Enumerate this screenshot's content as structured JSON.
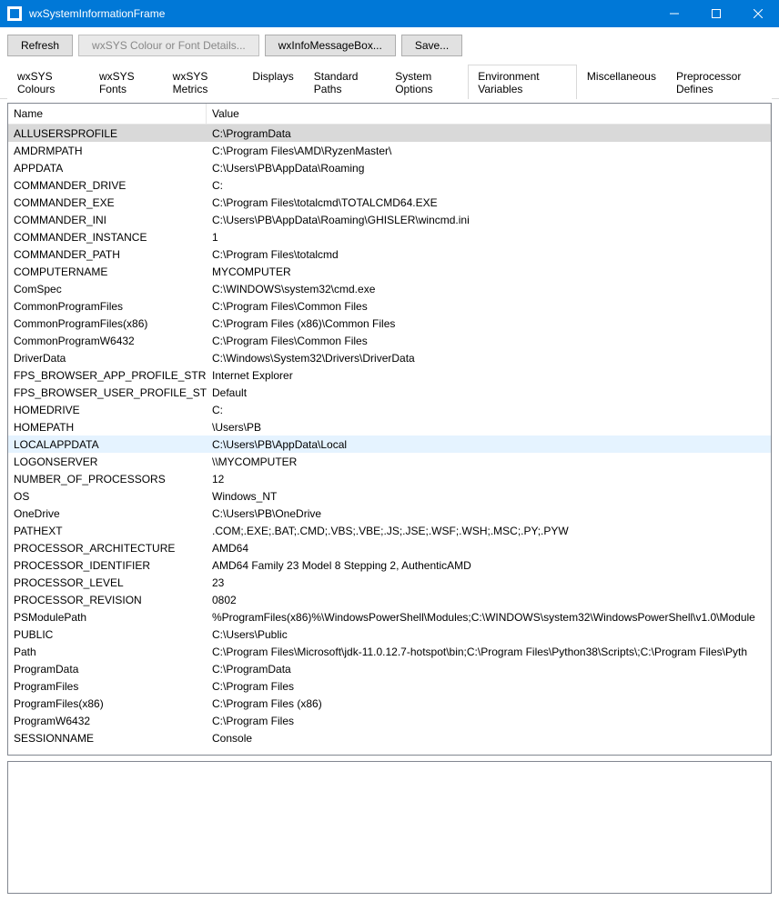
{
  "window": {
    "title": "wxSystemInformationFrame"
  },
  "toolbar": {
    "refresh": "Refresh",
    "colour_details": "wxSYS Colour or Font Details...",
    "info_msgbox": "wxInfoMessageBox...",
    "save": "Save..."
  },
  "tabs": {
    "items": [
      "wxSYS Colours",
      "wxSYS Fonts",
      "wxSYS Metrics",
      "Displays",
      "Standard Paths",
      "System Options",
      "Environment Variables",
      "Miscellaneous",
      "Preprocessor Defines"
    ],
    "active_index": 6
  },
  "columns": {
    "name": "Name",
    "value": "Value"
  },
  "rows": [
    {
      "name": "ALLUSERSPROFILE",
      "value": "C:\\ProgramData",
      "state": "selected"
    },
    {
      "name": "AMDRMPATH",
      "value": "C:\\Program Files\\AMD\\RyzenMaster\\"
    },
    {
      "name": "APPDATA",
      "value": "C:\\Users\\PB\\AppData\\Roaming"
    },
    {
      "name": "COMMANDER_DRIVE",
      "value": "C:"
    },
    {
      "name": "COMMANDER_EXE",
      "value": "C:\\Program Files\\totalcmd\\TOTALCMD64.EXE"
    },
    {
      "name": "COMMANDER_INI",
      "value": "C:\\Users\\PB\\AppData\\Roaming\\GHISLER\\wincmd.ini"
    },
    {
      "name": "COMMANDER_INSTANCE",
      "value": "1"
    },
    {
      "name": "COMMANDER_PATH",
      "value": "C:\\Program Files\\totalcmd"
    },
    {
      "name": "COMPUTERNAME",
      "value": "MYCOMPUTER"
    },
    {
      "name": "ComSpec",
      "value": "C:\\WINDOWS\\system32\\cmd.exe"
    },
    {
      "name": "CommonProgramFiles",
      "value": "C:\\Program Files\\Common Files"
    },
    {
      "name": "CommonProgramFiles(x86)",
      "value": "C:\\Program Files (x86)\\Common Files"
    },
    {
      "name": "CommonProgramW6432",
      "value": "C:\\Program Files\\Common Files"
    },
    {
      "name": "DriverData",
      "value": "C:\\Windows\\System32\\Drivers\\DriverData"
    },
    {
      "name": "FPS_BROWSER_APP_PROFILE_STRING",
      "value": "Internet Explorer"
    },
    {
      "name": "FPS_BROWSER_USER_PROFILE_STRING",
      "value": "Default"
    },
    {
      "name": "HOMEDRIVE",
      "value": "C:"
    },
    {
      "name": "HOMEPATH",
      "value": "\\Users\\PB"
    },
    {
      "name": "LOCALAPPDATA",
      "value": "C:\\Users\\PB\\AppData\\Local",
      "state": "hover"
    },
    {
      "name": "LOGONSERVER",
      "value": "\\\\MYCOMPUTER"
    },
    {
      "name": "NUMBER_OF_PROCESSORS",
      "value": "12"
    },
    {
      "name": "OS",
      "value": "Windows_NT"
    },
    {
      "name": "OneDrive",
      "value": "C:\\Users\\PB\\OneDrive"
    },
    {
      "name": "PATHEXT",
      "value": ".COM;.EXE;.BAT;.CMD;.VBS;.VBE;.JS;.JSE;.WSF;.WSH;.MSC;.PY;.PYW"
    },
    {
      "name": "PROCESSOR_ARCHITECTURE",
      "value": "AMD64"
    },
    {
      "name": "PROCESSOR_IDENTIFIER",
      "value": "AMD64 Family 23 Model 8 Stepping 2, AuthenticAMD"
    },
    {
      "name": "PROCESSOR_LEVEL",
      "value": "23"
    },
    {
      "name": "PROCESSOR_REVISION",
      "value": "0802"
    },
    {
      "name": "PSModulePath",
      "value": "%ProgramFiles(x86)%\\WindowsPowerShell\\Modules;C:\\WINDOWS\\system32\\WindowsPowerShell\\v1.0\\Module"
    },
    {
      "name": "PUBLIC",
      "value": "C:\\Users\\Public"
    },
    {
      "name": "Path",
      "value": "C:\\Program Files\\Microsoft\\jdk-11.0.12.7-hotspot\\bin;C:\\Program Files\\Python38\\Scripts\\;C:\\Program Files\\Pyth"
    },
    {
      "name": "ProgramData",
      "value": "C:\\ProgramData"
    },
    {
      "name": "ProgramFiles",
      "value": "C:\\Program Files"
    },
    {
      "name": "ProgramFiles(x86)",
      "value": "C:\\Program Files (x86)"
    },
    {
      "name": "ProgramW6432",
      "value": "C:\\Program Files"
    },
    {
      "name": "SESSIONNAME",
      "value": "Console"
    }
  ]
}
